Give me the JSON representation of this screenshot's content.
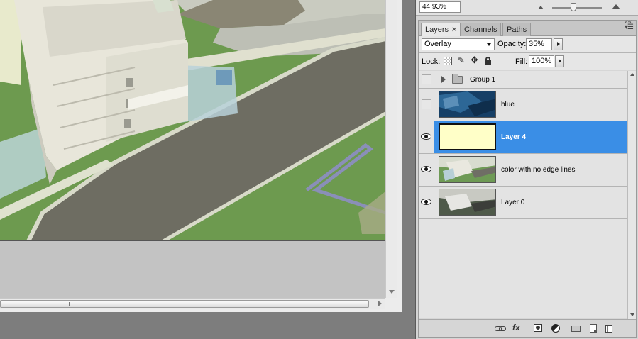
{
  "navigator": {
    "zoom": "44.93%"
  },
  "layers_panel": {
    "tabs": [
      {
        "label": "Layers",
        "active": true,
        "closable": true
      },
      {
        "label": "Channels",
        "active": false
      },
      {
        "label": "Paths",
        "active": false
      }
    ],
    "blend_mode": "Overlay",
    "opacity_label": "Opacity:",
    "opacity": "35%",
    "lock_label": "Lock:",
    "fill_label": "Fill:",
    "fill": "100%",
    "layers": [
      {
        "name": "Group 1",
        "type": "group",
        "visible": false,
        "selected": false
      },
      {
        "name": "blue",
        "type": "layer",
        "visible": false,
        "selected": false,
        "thumb": "blue-render"
      },
      {
        "name": "Layer 4",
        "type": "layer",
        "visible": true,
        "selected": true,
        "thumb": "pale-yellow-fill",
        "thumb_color": "#ffffc8"
      },
      {
        "name": "color with no edge lines",
        "type": "layer",
        "visible": true,
        "selected": false,
        "thumb": "color-render"
      },
      {
        "name": "Layer 0",
        "type": "layer",
        "visible": true,
        "selected": false,
        "thumb": "gray-render"
      }
    ],
    "bottom_icons": [
      "link-icon",
      "fx-icon",
      "mask-icon",
      "adjustment-icon",
      "new-group-icon",
      "new-layer-icon",
      "delete-icon"
    ]
  },
  "colors": {
    "selection": "#3a8ee6",
    "canvas_background": "#c3c3c3",
    "grass": "#6d9a4f",
    "road": "#6e6d62"
  }
}
